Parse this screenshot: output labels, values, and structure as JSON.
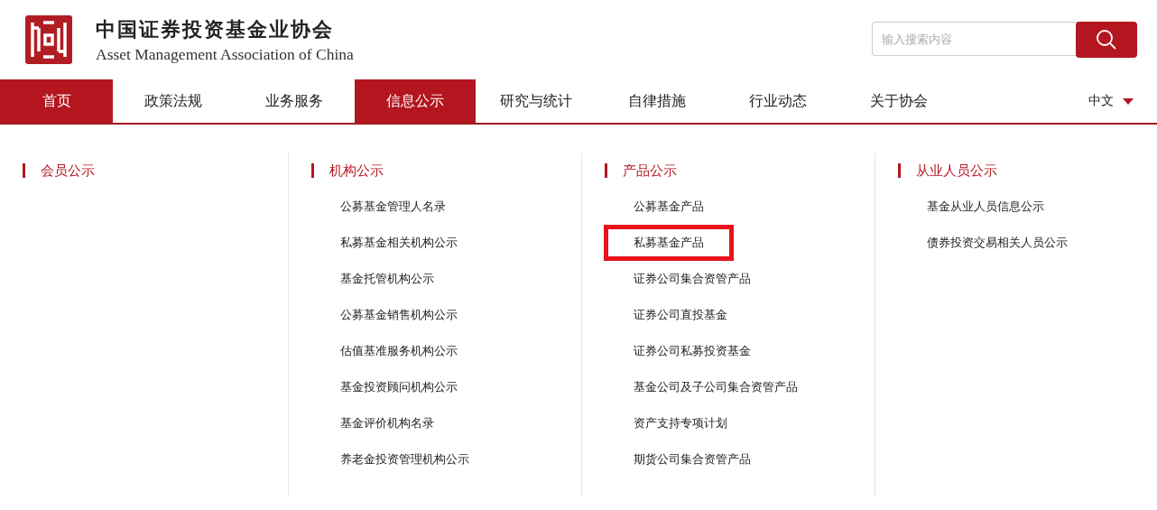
{
  "logo": {
    "title": "中国证券投资基金业协会",
    "subtitle": "Asset Management Association of China"
  },
  "search": {
    "placeholder": "输入搜索内容"
  },
  "nav": [
    {
      "label": "首页",
      "selected": true
    },
    {
      "label": "政策法规",
      "selected": false
    },
    {
      "label": "业务服务",
      "selected": false
    },
    {
      "label": "信息公示",
      "selected": true
    },
    {
      "label": "研究与统计",
      "selected": false
    },
    {
      "label": "自律措施",
      "selected": false
    },
    {
      "label": "行业动态",
      "selected": false
    },
    {
      "label": "关于协会",
      "selected": false
    }
  ],
  "language": "中文",
  "menu_columns": [
    {
      "heading": "会员公示"
    },
    {
      "heading": "机构公示",
      "items": [
        {
          "label": "公募基金管理人名录",
          "highlighted": false
        },
        {
          "label": "私募基金相关机构公示",
          "highlighted": false
        },
        {
          "label": "基金托管机构公示",
          "highlighted": false
        },
        {
          "label": "公募基金销售机构公示",
          "highlighted": false
        },
        {
          "label": "估值基准服务机构公示",
          "highlighted": false
        },
        {
          "label": "基金投资顾问机构公示",
          "highlighted": false
        },
        {
          "label": "基金评价机构名录",
          "highlighted": false
        },
        {
          "label": "养老金投资管理机构公示",
          "highlighted": false
        }
      ]
    },
    {
      "heading": "产品公示",
      "items": [
        {
          "label": "公募基金产品",
          "highlighted": false
        },
        {
          "label": "私募基金产品",
          "highlighted": true
        },
        {
          "label": "证券公司集合资管产品",
          "highlighted": false
        },
        {
          "label": "证券公司直投基金",
          "highlighted": false
        },
        {
          "label": "证券公司私募投资基金",
          "highlighted": false
        },
        {
          "label": "基金公司及子公司集合资管产品",
          "highlighted": false
        },
        {
          "label": "资产支持专项计划",
          "highlighted": false
        },
        {
          "label": "期货公司集合资管产品",
          "highlighted": false
        }
      ]
    },
    {
      "heading": "从业人员公示",
      "items": [
        {
          "label": "基金从业人员信息公示",
          "highlighted": false
        },
        {
          "label": "债券投资交易相关人员公示",
          "highlighted": false
        }
      ]
    }
  ]
}
